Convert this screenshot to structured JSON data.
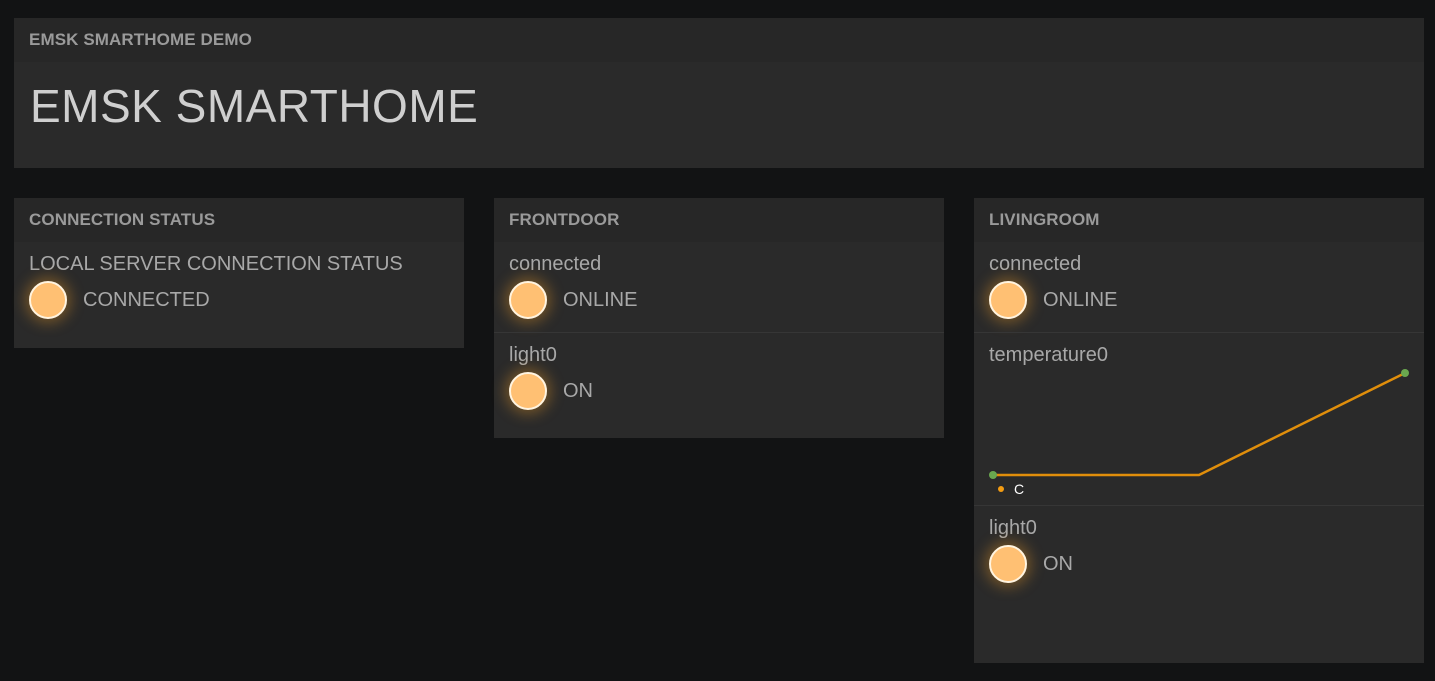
{
  "header": {
    "small_title": "EMSK SMARTHOME DEMO",
    "big_title": "EMSK SMARTHOME"
  },
  "panes": {
    "connection": {
      "title": "CONNECTION STATUS",
      "widget_label": "LOCAL SERVER CONNECTION STATUS",
      "status": "CONNECTED"
    },
    "frontdoor": {
      "title": "FRONTDOOR",
      "connected_label": "connected",
      "connected_status": "ONLINE",
      "light_label": "light0",
      "light_status": "ON"
    },
    "livingroom": {
      "title": "LIVINGROOM",
      "connected_label": "connected",
      "connected_status": "ONLINE",
      "temperature_label": "temperature0",
      "light_label": "light0",
      "light_status": "ON"
    }
  },
  "chart_data": {
    "type": "line",
    "title": "temperature0",
    "x": [
      0,
      1,
      2
    ],
    "series": [
      {
        "name": "C",
        "values": [
          0,
          0,
          1
        ],
        "color": "#e08e0b",
        "point_color": "#6aa84f"
      }
    ],
    "ylim": [
      0,
      1
    ],
    "grid": false,
    "legend": "bottom-left"
  },
  "colors": {
    "indicator_on": "#ffc073",
    "line": "#e08e0b",
    "legend_dot": "#f39c12",
    "point": "#6aa84f"
  }
}
